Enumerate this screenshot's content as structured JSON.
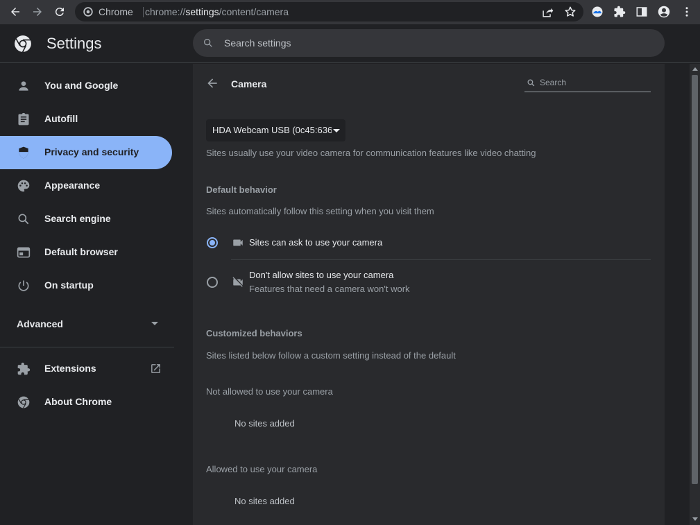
{
  "browser": {
    "site_label": "Chrome",
    "url_prefix": "chrome://",
    "url_host": "settings",
    "url_path": "/content/camera"
  },
  "header": {
    "title": "Settings",
    "search_placeholder": "Search settings"
  },
  "sidebar": {
    "items": [
      {
        "label": "You and Google",
        "icon": "person-icon"
      },
      {
        "label": "Autofill",
        "icon": "clipboard-icon"
      },
      {
        "label": "Privacy and security",
        "icon": "shield-icon",
        "active": true
      },
      {
        "label": "Appearance",
        "icon": "palette-icon"
      },
      {
        "label": "Search engine",
        "icon": "search-icon"
      },
      {
        "label": "Default browser",
        "icon": "browser-window-icon"
      },
      {
        "label": "On startup",
        "icon": "power-icon"
      }
    ],
    "advanced_label": "Advanced",
    "extensions_label": "Extensions",
    "about_label": "About Chrome"
  },
  "main": {
    "title": "Camera",
    "search_placeholder": "Search",
    "device_select": "HDA Webcam USB (0c45:6366)",
    "description": "Sites usually use your video camera for communication features like video chatting",
    "default_behavior": {
      "heading": "Default behavior",
      "subtext": "Sites automatically follow this setting when you visit them",
      "options": [
        {
          "label": "Sites can ask to use your camera",
          "selected": true
        },
        {
          "label": "Don't allow sites to use your camera",
          "sublabel": "Features that need a camera won't work",
          "selected": false
        }
      ]
    },
    "customized": {
      "heading": "Customized behaviors",
      "subtext": "Sites listed below follow a custom setting instead of the default",
      "not_allowed_label": "Not allowed to use your camera",
      "not_allowed_empty": "No sites added",
      "allowed_label": "Allowed to use your camera",
      "allowed_empty": "No sites added"
    }
  },
  "colors": {
    "accent": "#8ab4f8",
    "background": "#202124",
    "card": "#292a2d",
    "toolbar": "#35363a"
  }
}
